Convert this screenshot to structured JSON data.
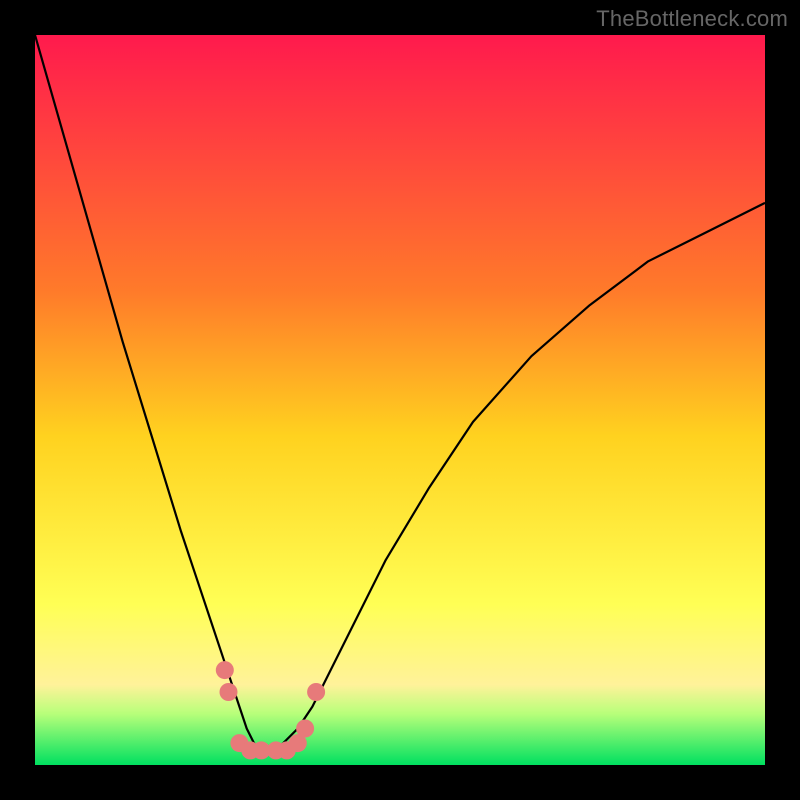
{
  "watermark": "TheBottleneck.com",
  "chart_data": {
    "type": "line",
    "title": "",
    "xlabel": "",
    "ylabel": "",
    "xlim": [
      0,
      100
    ],
    "ylim": [
      0,
      100
    ],
    "background_gradient": {
      "stops": [
        {
          "offset": 0,
          "color": "#ff1a4d"
        },
        {
          "offset": 35,
          "color": "#ff7a2a"
        },
        {
          "offset": 55,
          "color": "#ffd21f"
        },
        {
          "offset": 78,
          "color": "#ffff55"
        },
        {
          "offset": 89,
          "color": "#fff29a"
        },
        {
          "offset": 93,
          "color": "#b7ff7a"
        },
        {
          "offset": 100,
          "color": "#00e060"
        }
      ]
    },
    "series": [
      {
        "name": "curve",
        "color": "#000000",
        "x": [
          0,
          4,
          8,
          12,
          16,
          20,
          22,
          24,
          26,
          28,
          29,
          30,
          31,
          32,
          33,
          34,
          36,
          38,
          40,
          44,
          48,
          54,
          60,
          68,
          76,
          84,
          92,
          100
        ],
        "y": [
          100,
          86,
          72,
          58,
          45,
          32,
          26,
          20,
          14,
          8,
          5,
          3,
          2,
          2,
          2,
          3,
          5,
          8,
          12,
          20,
          28,
          38,
          47,
          56,
          63,
          69,
          73,
          77
        ]
      }
    ],
    "markers": {
      "color": "#e77a7a",
      "radius": 9,
      "points": [
        {
          "x": 26.0,
          "y": 13
        },
        {
          "x": 26.5,
          "y": 10
        },
        {
          "x": 28.0,
          "y": 3
        },
        {
          "x": 29.5,
          "y": 2
        },
        {
          "x": 31.0,
          "y": 2
        },
        {
          "x": 33.0,
          "y": 2
        },
        {
          "x": 34.5,
          "y": 2
        },
        {
          "x": 36.0,
          "y": 3
        },
        {
          "x": 37.0,
          "y": 5
        },
        {
          "x": 38.5,
          "y": 10
        }
      ]
    }
  }
}
